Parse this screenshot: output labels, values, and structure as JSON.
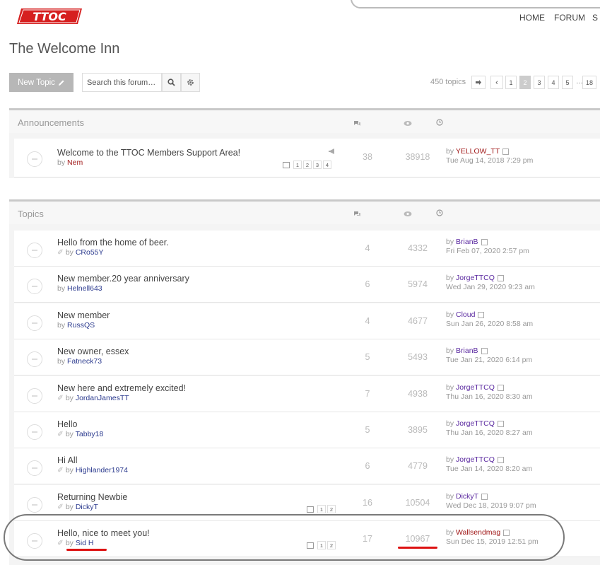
{
  "logo": {
    "text": "TTOC",
    "color": "#d61f1f"
  },
  "nav": {
    "items": [
      "HOME",
      "FORUM",
      "S"
    ]
  },
  "page": {
    "title": "The Welcome Inn"
  },
  "toolbar": {
    "new_topic_label": "New Topic",
    "search_placeholder": "Search this forum…",
    "topics_count": "450 topics",
    "pages": [
      "1",
      "2",
      "3",
      "4",
      "5",
      "18"
    ],
    "current_page": "2",
    "ellipsis": "…"
  },
  "announcements": {
    "label": "Announcements",
    "rows": [
      {
        "title": "Welcome to the TTOC Members Support Area!",
        "author": "Nem",
        "pages": [
          "1",
          "2",
          "3",
          "4"
        ],
        "replies": "38",
        "views": "38918",
        "last_user": "YELLOW_TT",
        "last_time": "Tue Aug 14, 2018 7:29 pm"
      }
    ]
  },
  "topics": {
    "label": "Topics",
    "rows": [
      {
        "title": "Hello from the home of beer.",
        "author": "CRo55Y",
        "replies": "4",
        "views": "4332",
        "last_user": "BrianB",
        "last_time": "Fri Feb 07, 2020 2:57 pm"
      },
      {
        "title": "New member.20 year anniversary",
        "author": "Helnell643",
        "replies": "6",
        "views": "5974",
        "last_user": "JorgeTTCQ",
        "last_time": "Wed Jan 29, 2020 9:23 am"
      },
      {
        "title": "New member",
        "author": "RussQS",
        "replies": "4",
        "views": "4677",
        "last_user": "Cloud",
        "last_time": "Sun Jan 26, 2020 8:58 am"
      },
      {
        "title": "New owner, essex",
        "author": "Fatneck73",
        "replies": "5",
        "views": "5493",
        "last_user": "BrianB",
        "last_time": "Tue Jan 21, 2020 6:14 pm"
      },
      {
        "title": "New here and extremely excited!",
        "author": "JordanJamesTT",
        "replies": "7",
        "views": "4938",
        "last_user": "JorgeTTCQ",
        "last_time": "Thu Jan 16, 2020 8:30 am"
      },
      {
        "title": "Hello",
        "author": "Tabby18",
        "replies": "5",
        "views": "3895",
        "last_user": "JorgeTTCQ",
        "last_time": "Thu Jan 16, 2020 8:27 am"
      },
      {
        "title": "Hi All",
        "author": "Highlander1974",
        "replies": "6",
        "views": "4779",
        "last_user": "JorgeTTCQ",
        "last_time": "Tue Jan 14, 2020 8:20 am"
      },
      {
        "title": "Returning Newbie",
        "author": "DickyT",
        "pages": [
          "1",
          "2"
        ],
        "replies": "16",
        "views": "10504",
        "last_user": "DickyT",
        "last_time": "Wed Dec 18, 2019 9:07 pm"
      },
      {
        "title": "Hello, nice to meet you!",
        "author": "Sid H",
        "pages": [
          "1",
          "2"
        ],
        "replies": "17",
        "views": "10967",
        "last_user": "Wallsendmag",
        "last_time": "Sun Dec 15, 2019 12:51 pm"
      }
    ]
  },
  "common": {
    "by": "by"
  },
  "colors": {
    "accent_red": "#d11111",
    "author_blue": "#2b3a8e",
    "last_user_purple": "#5b2aa0"
  }
}
